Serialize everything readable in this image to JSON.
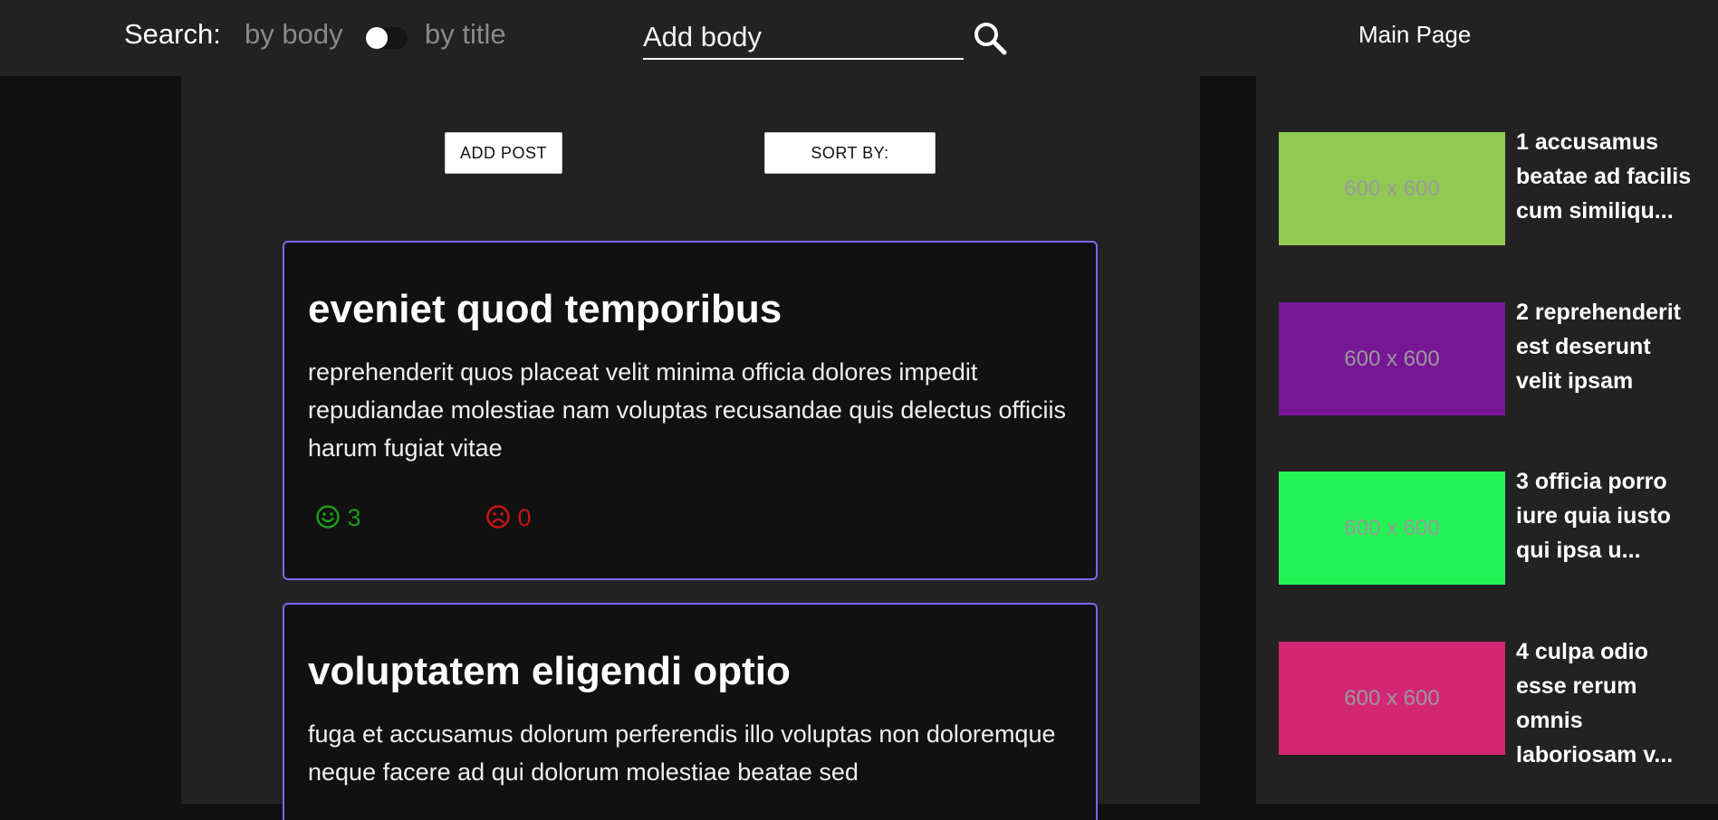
{
  "header": {
    "search_label": "Search:",
    "mode_body": "by body",
    "mode_title": "by title",
    "search_placeholder": "Add body",
    "main_link": "Main Page"
  },
  "toolbar": {
    "add_post": "ADD POST",
    "sort_by": "SORT BY:"
  },
  "posts": [
    {
      "title": "eveniet quod temporibus",
      "body": "reprehenderit quos placeat velit minima officia dolores impedit repudiandae molestiae nam voluptas recusandae quis delectus officiis harum fugiat vitae",
      "likes": "3",
      "dislikes": "0"
    },
    {
      "title": "voluptatem eligendi optio",
      "body": "fuga et accusamus dolorum perferendis illo voluptas non doloremque neque facere ad qui dolorum molestiae beatae sed"
    }
  ],
  "sidebar": {
    "items": [
      {
        "thumb_text": "600 x 600",
        "thumb_color": "#92c952",
        "title": "1 accusamus beatae ad facilis cum similiqu..."
      },
      {
        "thumb_text": "600 x 600",
        "thumb_color": "#771796",
        "title": "2 reprehenderit est deserunt velit ipsam"
      },
      {
        "thumb_text": "600 x 600",
        "thumb_color": "#24f355",
        "title": "3 officia porro iure quia iusto qui ipsa u..."
      },
      {
        "thumb_text": "600 x 600",
        "thumb_color": "#d32776",
        "title": "4 culpa odio esse rerum omnis laboriosam v..."
      }
    ]
  },
  "colors": {
    "card_border": "#7b68ee",
    "like": "#1a9a1a",
    "dislike": "#c81515"
  }
}
